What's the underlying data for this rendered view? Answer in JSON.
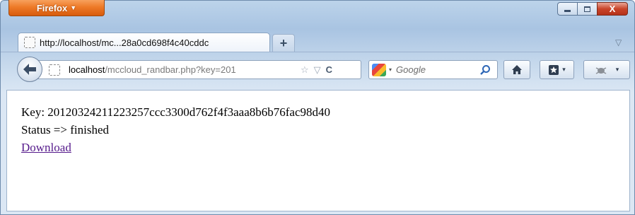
{
  "browser": {
    "app_button_label": "Firefox",
    "caption": {
      "minimize": "",
      "maximize": "",
      "close": "X"
    }
  },
  "tab": {
    "title": "http://localhost/mc...28a0cd698f4c40cddc",
    "new_tab_label": "+",
    "list_tabs_label": "▽"
  },
  "navigation": {
    "url_host": "localhost",
    "url_path": "/mccloud_randbar.php?key=201",
    "search_placeholder": "Google",
    "search_engine_caret": "▾",
    "addon_caret": "▾",
    "bookmarks_caret": "▾"
  },
  "content": {
    "key_line": "Key: 20120324211223257ccc3300d762f4f3aaa8b6b76fac98d40",
    "status_line": "Status => finished",
    "download_link": "Download"
  },
  "colors": {
    "app_button": "#ee7a28",
    "close_button": "#c9442a",
    "visited_link": "#551a8b"
  }
}
